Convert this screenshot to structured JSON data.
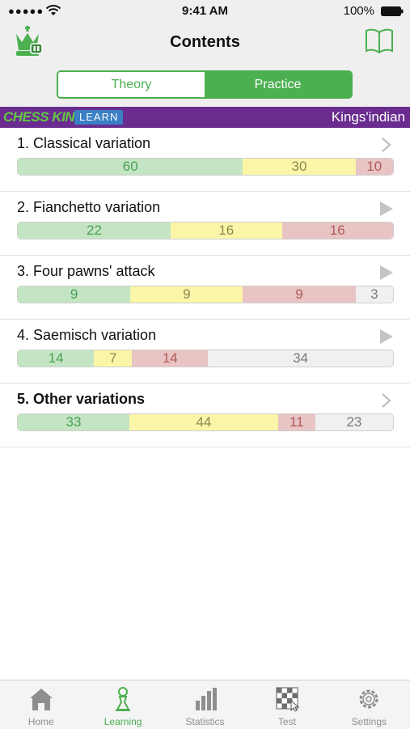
{
  "status_bar": {
    "signal": "●●●●●",
    "time": "9:41 AM",
    "battery": "100%"
  },
  "nav": {
    "title": "Contents",
    "segments": [
      "Theory",
      "Practice"
    ],
    "selected_segment": "Practice"
  },
  "banner": {
    "brand": "CHESS KING",
    "badge": "LEARN",
    "opening": "Kings'indian"
  },
  "colors": {
    "accent": "#4caf50",
    "banner": "#6a2c8e",
    "correct": "#c4e5c3",
    "partial": "#fbf5a8",
    "wrong": "#e8c4c4",
    "unsolved": "#f0f0f0"
  },
  "items": [
    {
      "title": "1. Classical variation",
      "bold": false,
      "icon": "chevron-right-icon",
      "segments": [
        {
          "value": "60",
          "status": "green"
        },
        {
          "value": "30",
          "status": "yellow"
        },
        {
          "value": "10",
          "status": "red"
        }
      ]
    },
    {
      "title": "2. Fianchetto variation",
      "bold": false,
      "icon": "play-icon",
      "segments": [
        {
          "value": "22",
          "status": "green"
        },
        {
          "value": "16",
          "status": "yellow"
        },
        {
          "value": "16",
          "status": "red"
        }
      ]
    },
    {
      "title": "3. Four pawns' attack",
      "bold": false,
      "icon": "play-icon",
      "segments": [
        {
          "value": "9",
          "status": "green"
        },
        {
          "value": "9",
          "status": "yellow"
        },
        {
          "value": "9",
          "status": "red"
        },
        {
          "value": "3",
          "status": "grey"
        }
      ]
    },
    {
      "title": "4. Saemisch variation",
      "bold": false,
      "icon": "play-icon",
      "segments": [
        {
          "value": "14",
          "status": "green"
        },
        {
          "value": "7",
          "status": "yellow"
        },
        {
          "value": "14",
          "status": "red"
        },
        {
          "value": "34",
          "status": "grey"
        }
      ]
    },
    {
      "title": "5. Other variations",
      "bold": true,
      "icon": "chevron-right-icon",
      "segments": [
        {
          "value": "33",
          "status": "green"
        },
        {
          "value": "44",
          "status": "yellow"
        },
        {
          "value": "11",
          "status": "red"
        },
        {
          "value": "23",
          "status": "grey"
        }
      ]
    }
  ],
  "tabs": [
    {
      "label": "Home",
      "icon": "home-icon",
      "active": false
    },
    {
      "label": "Learning",
      "icon": "pawn-icon",
      "active": true
    },
    {
      "label": "Statistics",
      "icon": "bar-chart-icon",
      "active": false
    },
    {
      "label": "Test",
      "icon": "chessboard-icon",
      "active": false
    },
    {
      "label": "Settings",
      "icon": "gear-icon",
      "active": false
    }
  ]
}
